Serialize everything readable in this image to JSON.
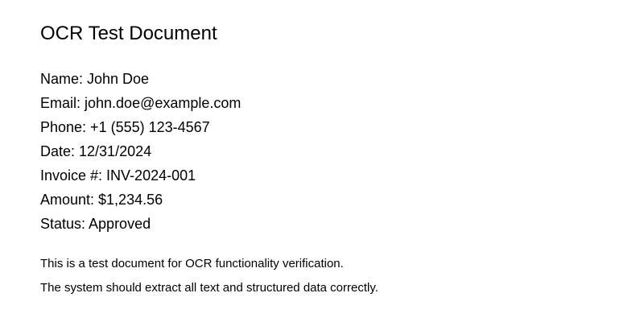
{
  "document": {
    "title": "OCR Test Document",
    "fields": [
      "Name: John Doe",
      "Email: john.doe@example.com",
      "Phone: +1 (555) 123-4567",
      "Date: 12/31/2024",
      "Invoice #: INV-2024-001",
      "Amount: $1,234.56",
      "Status: Approved"
    ],
    "notes": [
      "This is a test document for OCR functionality verification.",
      "The system should extract all text and structured data correctly."
    ]
  }
}
